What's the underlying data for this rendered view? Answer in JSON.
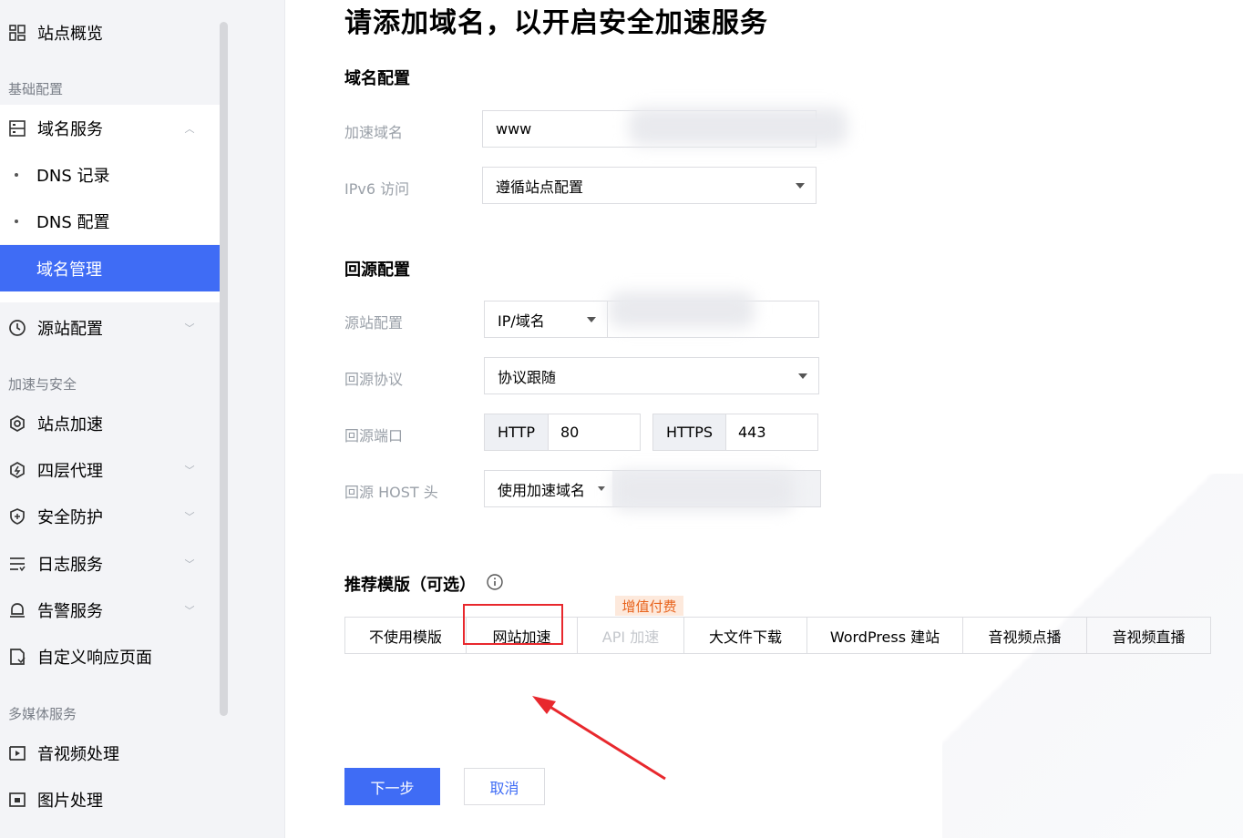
{
  "sidebar": {
    "overview": "站点概览",
    "section_basic": "基础配置",
    "domain_service": "域名服务",
    "dns_records": "DNS 记录",
    "dns_config": "DNS 配置",
    "domain_manage": "域名管理",
    "origin_config": "源站配置",
    "section_accel": "加速与安全",
    "site_accel": "站点加速",
    "l4_proxy": "四层代理",
    "security": "安全防护",
    "log_service": "日志服务",
    "alert_service": "告警服务",
    "custom_response": "自定义响应页面",
    "section_media": "多媒体服务",
    "av_processing": "音视频处理",
    "image_processing": "图片处理"
  },
  "main": {
    "title": "请添加域名，以开启安全加速服务",
    "domain_section": "域名配置",
    "accel_domain_label": "加速域名",
    "accel_domain_value": "www",
    "ipv6_label": "IPv6 访问",
    "ipv6_value": "遵循站点配置",
    "origin_section": "回源配置",
    "origin_site_label": "源站配置",
    "origin_site_type": "IP/域名",
    "origin_protocol_label": "回源协议",
    "origin_protocol_value": "协议跟随",
    "origin_port_label": "回源端口",
    "http_label": "HTTP",
    "http_port": "80",
    "https_label": "HTTPS",
    "https_port": "443",
    "host_label": "回源 HOST 头",
    "host_value": "使用加速域名",
    "template_section": "推荐模版（可选）",
    "paid_badge": "增值付费",
    "templates": [
      "不使用模版",
      "网站加速",
      "API 加速",
      "大文件下载",
      "WordPress 建站",
      "音视频点播",
      "音视频直播"
    ],
    "next_button": "下一步",
    "cancel_button": "取消"
  },
  "colors": {
    "primary": "#3f6cf5",
    "highlight": "#e8282d",
    "badge_bg": "#fde9dc",
    "badge_text": "#e8631c"
  }
}
